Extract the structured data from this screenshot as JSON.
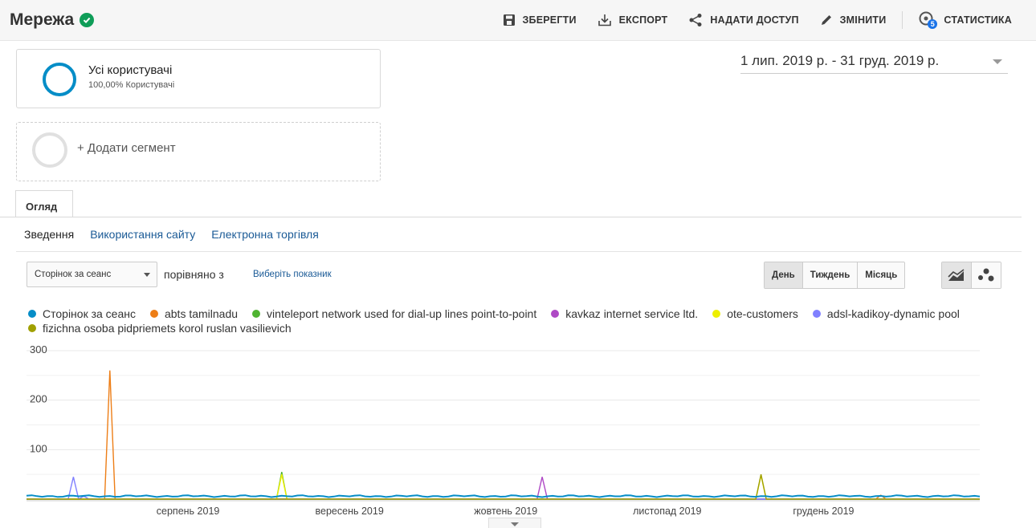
{
  "header": {
    "title": "Мережа",
    "actions": {
      "save": "ЗБЕРЕГТИ",
      "export": "ЕКСПОРТ",
      "share": "НАДАТИ ДОСТУП",
      "edit": "ЗМІНИТИ",
      "insights": "СТАТИСТИКА",
      "insights_badge": "5"
    }
  },
  "segments": {
    "active": {
      "name": "Усі користувачі",
      "subtitle": "100,00% Користувачі",
      "color": "#058dc7"
    },
    "add_label": "+ Додати сегмент"
  },
  "date_range": "1 лип. 2019 р. - 31 груд. 2019 р.",
  "tabs": {
    "overview": "Огляд"
  },
  "subnav": {
    "summary": "Зведення",
    "site_usage": "Використання сайту",
    "ecommerce": "Електронна торгівля"
  },
  "controls": {
    "metric": "Сторінок за сеанс",
    "compare_label": "порівняно з",
    "choose_metric": "Виберіть показник",
    "periods": {
      "day": "День",
      "week": "Тиждень",
      "month": "Місяць"
    },
    "view_icons": [
      "line-chart-icon",
      "motion-chart-icon"
    ]
  },
  "chart_data": {
    "type": "line",
    "ylim": [
      0,
      300
    ],
    "y_ticks": [
      "300",
      "200",
      "100"
    ],
    "y_tick_values": [
      300,
      200,
      100
    ],
    "x_tick_labels": [
      "серпень 2019",
      "вересень 2019",
      "жовтень 2019",
      "листопад 2019",
      "грудень 2019"
    ],
    "x_tick_days": [
      31,
      62,
      92,
      123,
      153
    ],
    "day_count": 184,
    "series": [
      {
        "name": "Сторінок за сеанс",
        "color": "#058dc7",
        "baseline": 6,
        "spikes": []
      },
      {
        "name": "abts tamilnadu",
        "color": "#ed7e17",
        "baseline": 0,
        "spikes": [
          [
            16,
            260
          ],
          [
            164,
            8
          ]
        ]
      },
      {
        "name": "vinteleport network used for dial-up lines point-to-point",
        "color": "#50b432",
        "baseline": 0,
        "spikes": [
          [
            49,
            55
          ]
        ]
      },
      {
        "name": "kavkaz internet service ltd.",
        "color": "#af49c5",
        "baseline": 0,
        "spikes": [
          [
            99,
            45
          ]
        ]
      },
      {
        "name": "ote-customers",
        "color": "#edef00",
        "baseline": 0,
        "spikes": [
          [
            49,
            50
          ],
          [
            141,
            48
          ]
        ]
      },
      {
        "name": "adsl-kadikoy-dynamic pool",
        "color": "#8080ff",
        "baseline": 0,
        "spikes": [
          [
            9,
            45
          ],
          [
            11,
            6
          ]
        ]
      },
      {
        "name": "fizichna osoba pidpriemets korol ruslan vasilievich",
        "color": "#a0a000",
        "baseline": 0,
        "spikes": [
          [
            141,
            50
          ]
        ]
      }
    ]
  }
}
